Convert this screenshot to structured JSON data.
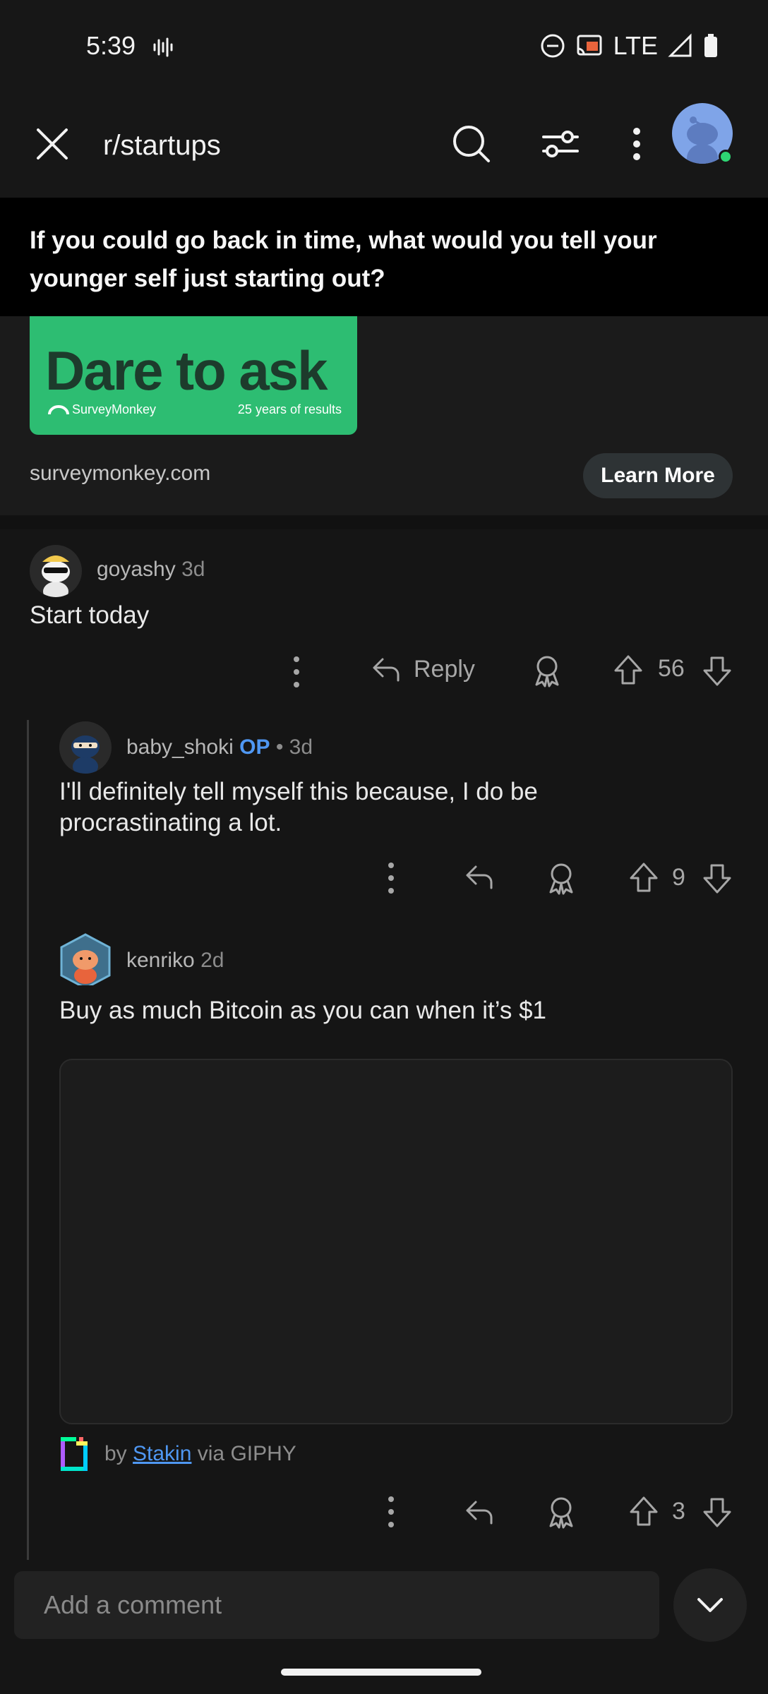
{
  "status_bar": {
    "time": "5:39",
    "network": "LTE"
  },
  "toolbar": {
    "title": "r/startups"
  },
  "post": {
    "title": "If you could go back in time, what would you tell your younger self just starting out?"
  },
  "ad": {
    "headline": "Dare to ask",
    "brand": "SurveyMonkey",
    "tagline": "25 years of results",
    "domain": "surveymonkey.com",
    "cta": "Learn More",
    "banner_color": "#2dbd72"
  },
  "comments": [
    {
      "user": "goyashy",
      "age": "3d",
      "body": "Start today",
      "reply_label": "Reply",
      "votes": "56"
    },
    {
      "user": "baby_shoki",
      "op_badge": "OP",
      "age": "• 3d",
      "body": "I'll definitely tell myself this because, I do be procrastinating a lot.",
      "votes": "9"
    },
    {
      "user": "kenriko",
      "age": "2d",
      "body": "Buy as much Bitcoin as you can when it’s $1",
      "gif_credit_by": "by",
      "gif_credit_author": "Stakin",
      "gif_credit_via": "via GIPHY",
      "votes": "3"
    }
  ],
  "composer": {
    "placeholder": "Add a comment"
  },
  "colors": {
    "accent": "#4f97f2",
    "online": "#2ed573"
  }
}
